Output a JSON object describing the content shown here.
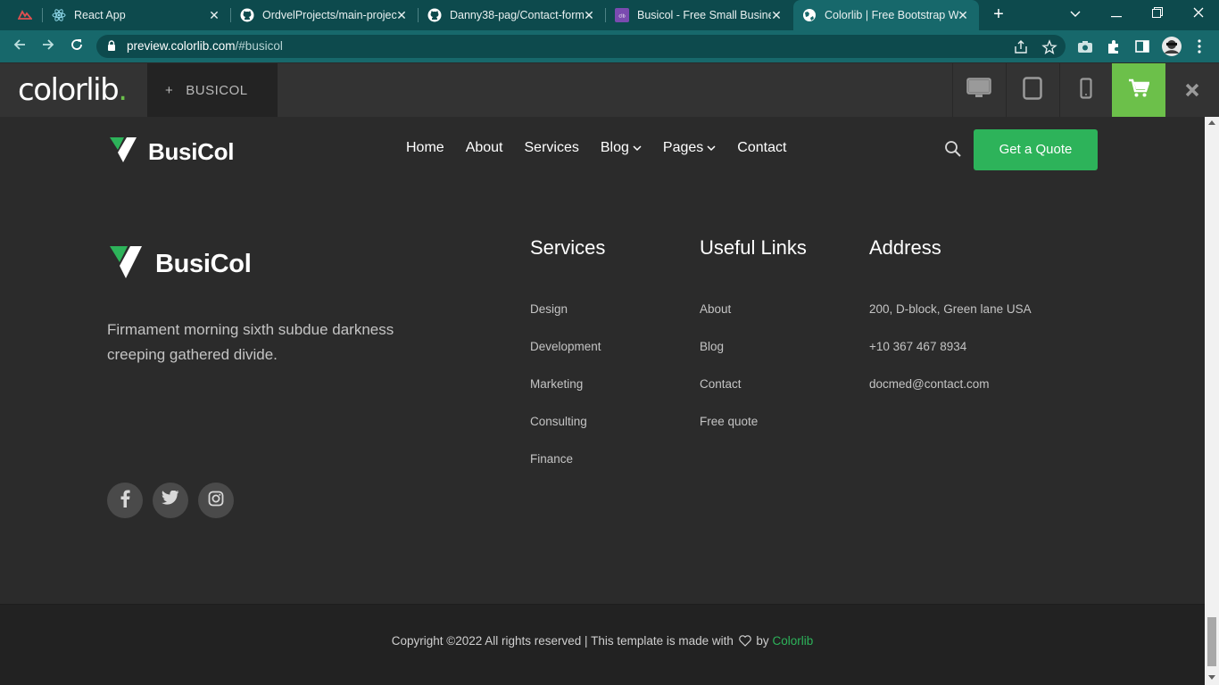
{
  "browser": {
    "tabs": [
      {
        "title": "",
        "icon": "app-icon"
      },
      {
        "title": "React App",
        "icon": "react-icon"
      },
      {
        "title": "OrdvelProjects/main-projec",
        "icon": "github-icon"
      },
      {
        "title": "Danny38-pag/Contact-form",
        "icon": "github-icon"
      },
      {
        "title": "Busicol - Free Small Busines",
        "icon": "colorlib-icon"
      },
      {
        "title": "Colorlib | Free Bootstrap W",
        "icon": "globe-icon",
        "active": true
      }
    ],
    "url_host": "preview.colorlib.com",
    "url_path": "/#busicol"
  },
  "colorlib_bar": {
    "logo_text": "colorlib",
    "logo_dot": ".",
    "theme_label": "+   BUSICOL",
    "devices": [
      "desktop-icon",
      "tablet-icon",
      "mobile-icon"
    ],
    "accent": "#6cc04a"
  },
  "site": {
    "brand": "BusiCol",
    "nav": [
      {
        "label": "Home"
      },
      {
        "label": "About"
      },
      {
        "label": "Services"
      },
      {
        "label": "Blog",
        "dropdown": true
      },
      {
        "label": "Pages",
        "dropdown": true
      },
      {
        "label": "Contact"
      }
    ],
    "cta": "Get a Quote",
    "accent": "#2db35a"
  },
  "footer": {
    "brand": "BusiCol",
    "description": "Firmament morning sixth subdue darkness creeping gathered divide.",
    "social": [
      "facebook-icon",
      "twitter-icon",
      "instagram-icon"
    ],
    "columns": [
      {
        "title": "Services",
        "items": [
          "Design",
          "Development",
          "Marketing",
          "Consulting",
          "Finance"
        ]
      },
      {
        "title": "Useful Links",
        "items": [
          "About",
          "Blog",
          "Contact",
          "Free quote"
        ]
      },
      {
        "title": "Address",
        "items": [
          "200, D-block, Green lane USA",
          "+10 367 467 8934",
          "docmed@contact.com"
        ]
      }
    ],
    "copyright_text": "Copyright ©2022 All rights reserved | This template is made with",
    "copyright_by": "by",
    "copyright_link": "Colorlib"
  }
}
